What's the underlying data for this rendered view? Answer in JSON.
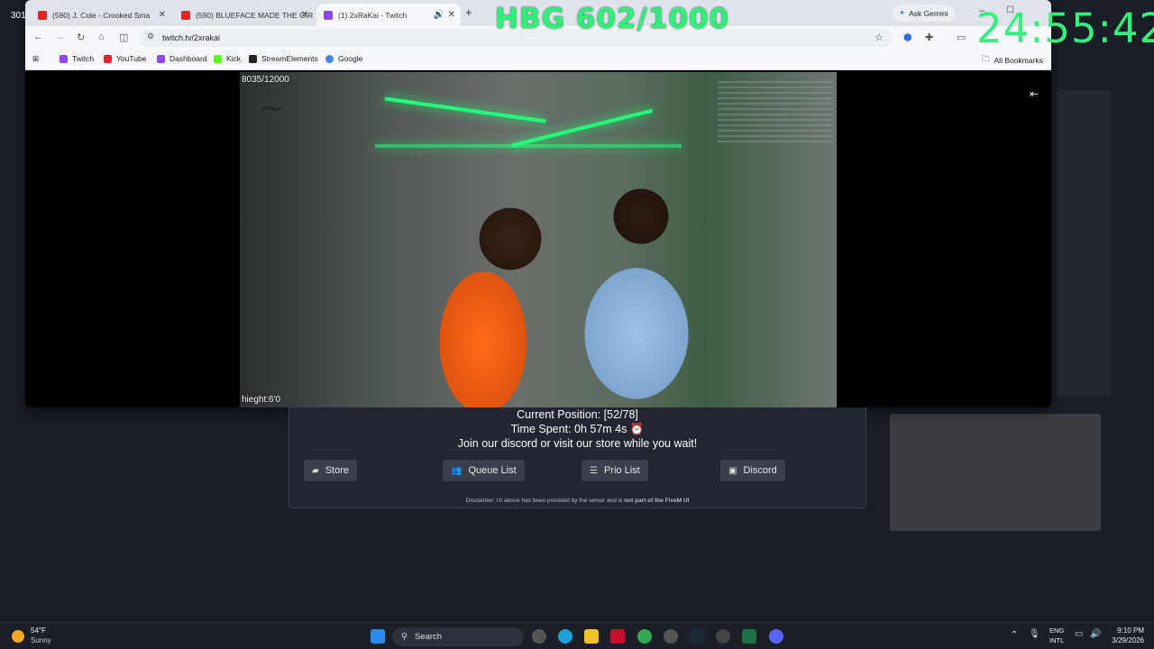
{
  "overlay": {
    "hbg": "HBG 602/1000",
    "clock": "24:55:42",
    "corner": "301"
  },
  "browser": {
    "tabs": [
      {
        "title": "(590) J. Cole - Crooked Sma",
        "color": "#e3242b"
      },
      {
        "title": "(590) BLUEFACE MADE THE GIR",
        "color": "#e3242b"
      },
      {
        "title": "(1) 2xRaKai - Twitch",
        "color": "#8c45f7"
      }
    ],
    "new_tab": "+",
    "ask_gemini": "Ask Gemini",
    "url": "twitch.tv/2xrakai",
    "bookmarks": [
      {
        "label": "Twitch",
        "color": "#9146ff"
      },
      {
        "label": "YouTube",
        "color": "#e3242b"
      },
      {
        "label": "Dashboard",
        "color": "#9146ff"
      },
      {
        "label": "Kick",
        "color": "#53fc18"
      },
      {
        "label": "StreamElements",
        "color": "#222"
      },
      {
        "label": "Google",
        "color": "#4285f4"
      }
    ],
    "all_bookmarks": "All Bookmarks"
  },
  "video": {
    "top_left": "8035/12000",
    "bottom_left": "hieght:6'0"
  },
  "queue": {
    "position": "Current Position: [52/78]",
    "time": "Time Spent: 0h 57m 4s ⏰",
    "join": "Join our discord or visit our store while you wait!",
    "buttons": [
      {
        "label": "Store",
        "icon": "store-icon"
      },
      {
        "label": "Queue List",
        "icon": "users-icon"
      },
      {
        "label": "Prio List",
        "icon": "list-icon"
      },
      {
        "label": "Discord",
        "icon": "discord-icon"
      }
    ],
    "disclaimer": "Disclaimer: UI above has been provided by the server and is",
    "disclaimer_bold": "not part of the FiveM UI"
  },
  "taskbar": {
    "weather_temp": "54°F",
    "weather_desc": "Sunny",
    "search": "Search",
    "lang1": "ENG",
    "lang2": "INTL",
    "time": "9:10 PM",
    "date": "3/29/2026"
  }
}
